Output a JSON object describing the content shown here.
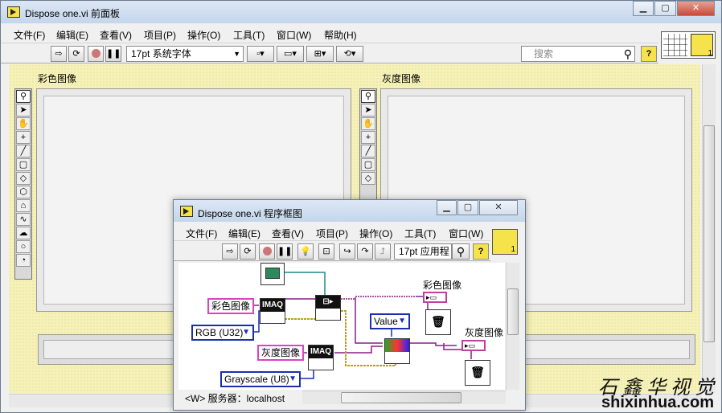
{
  "front_panel": {
    "title": "Dispose one.vi 前面板",
    "menus": [
      "文件(F)",
      "编辑(E)",
      "查看(V)",
      "项目(P)",
      "操作(O)",
      "工具(T)",
      "窗口(W)",
      "帮助(H)"
    ],
    "font_selector": "17pt 系统字体",
    "search_placeholder": "搜索",
    "help_glyph": "?",
    "color_image_label": "彩色图像",
    "gray_image_label": "灰度图像",
    "connector_number": "1"
  },
  "block_diagram": {
    "title": "Dispose one.vi 程序框图",
    "menus": [
      "文件(F)",
      "编辑(E)",
      "查看(V)",
      "项目(P)",
      "操作(O)",
      "工具(T)",
      "窗口(W)"
    ],
    "font_selector": "17pt 应用程",
    "connector_number": "1",
    "nodes": {
      "color_image_const": "彩色图像",
      "rgb_enum": "RGB (U32)",
      "gray_image_const": "灰度图像",
      "grayscale_enum": "Grayscale (U8)",
      "value_enum": "Value",
      "imaq_label": "IMAQ",
      "color_indicator_label": "彩色图像",
      "gray_indicator_label": "灰度图像"
    },
    "status_text": "<W> 服务器：localhost"
  },
  "watermark": {
    "chinese": "石鑫华视觉",
    "url": "shixinhua.com"
  },
  "colors": {
    "panel_bg": "#f5f1b8",
    "image_wire": "#8a1e8a",
    "enum_wire": "#1a2fb0",
    "title_gradient_top": "#dbe7f5"
  }
}
